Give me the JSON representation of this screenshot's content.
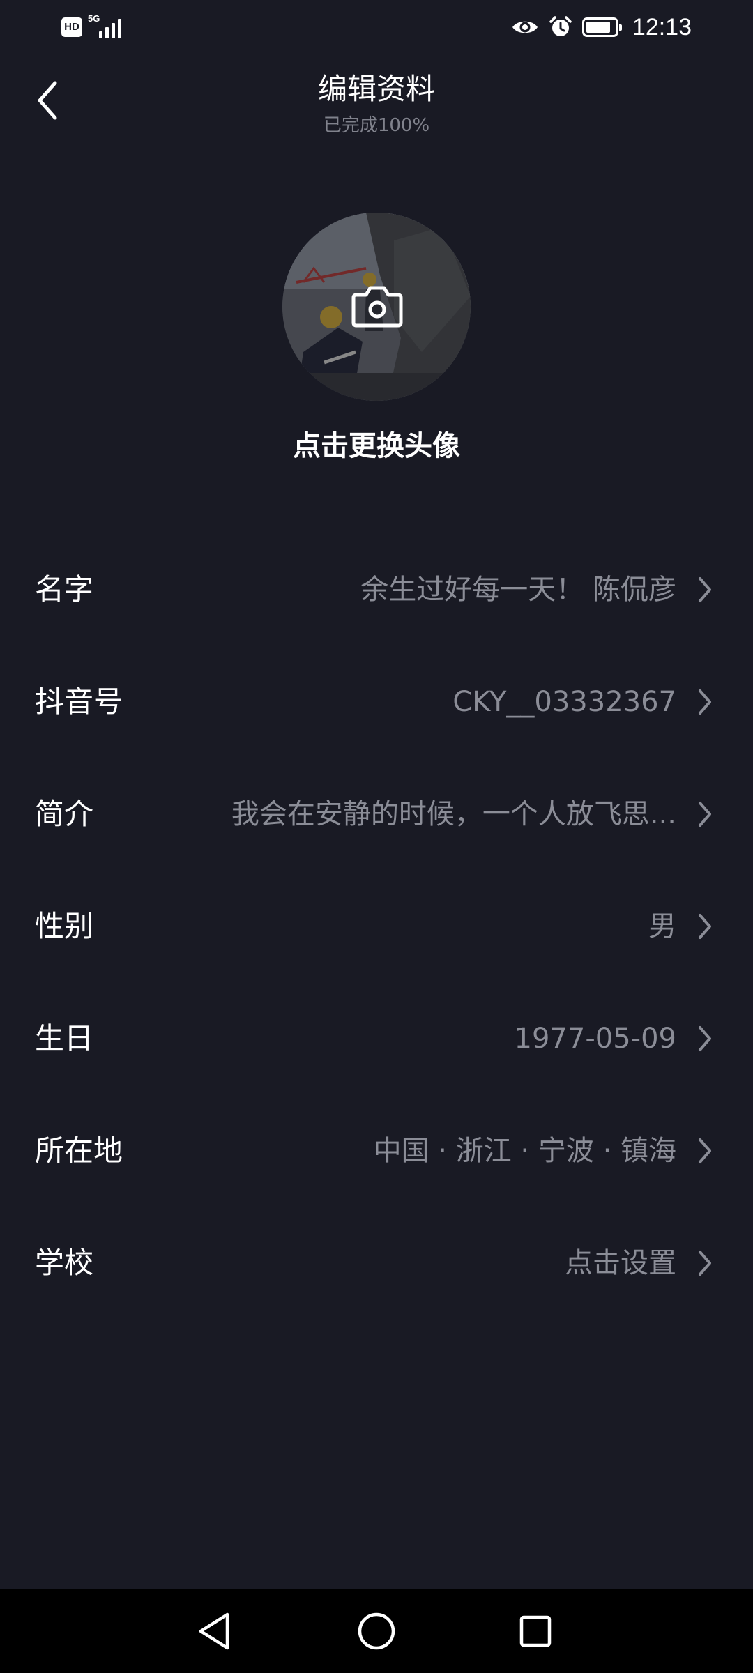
{
  "status_bar": {
    "hd_label": "HD",
    "network_label": "5G",
    "time": "12:13",
    "icons": [
      "signal-icon",
      "eye-icon",
      "alarm-icon",
      "battery-icon"
    ]
  },
  "header": {
    "title": "编辑资料",
    "subtitle": "已完成100%",
    "back_icon": "chevron-left-icon"
  },
  "avatar": {
    "change_label": "点击更换头像",
    "overlay_icon": "camera-icon"
  },
  "profile_rows": [
    {
      "label": "名字",
      "value": "余生过好每一天！ 陈侃彦"
    },
    {
      "label": "抖音号",
      "value": "CKY__03332367"
    },
    {
      "label": "简介",
      "value": "我会在安静的时候，一个人放飞思..."
    },
    {
      "label": "性别",
      "value": "男"
    },
    {
      "label": "生日",
      "value": "1977-05-09"
    },
    {
      "label": "所在地",
      "value": "中国 · 浙江 · 宁波 · 镇海"
    },
    {
      "label": "学校",
      "value": "点击设置"
    }
  ],
  "nav_bar": {
    "buttons": [
      "back-triangle-icon",
      "home-circle-icon",
      "recents-square-icon"
    ]
  },
  "colors": {
    "background": "#191a24",
    "primary_text": "#ffffff",
    "secondary_text": "#8b8d97",
    "nav_bar": "#000000"
  }
}
